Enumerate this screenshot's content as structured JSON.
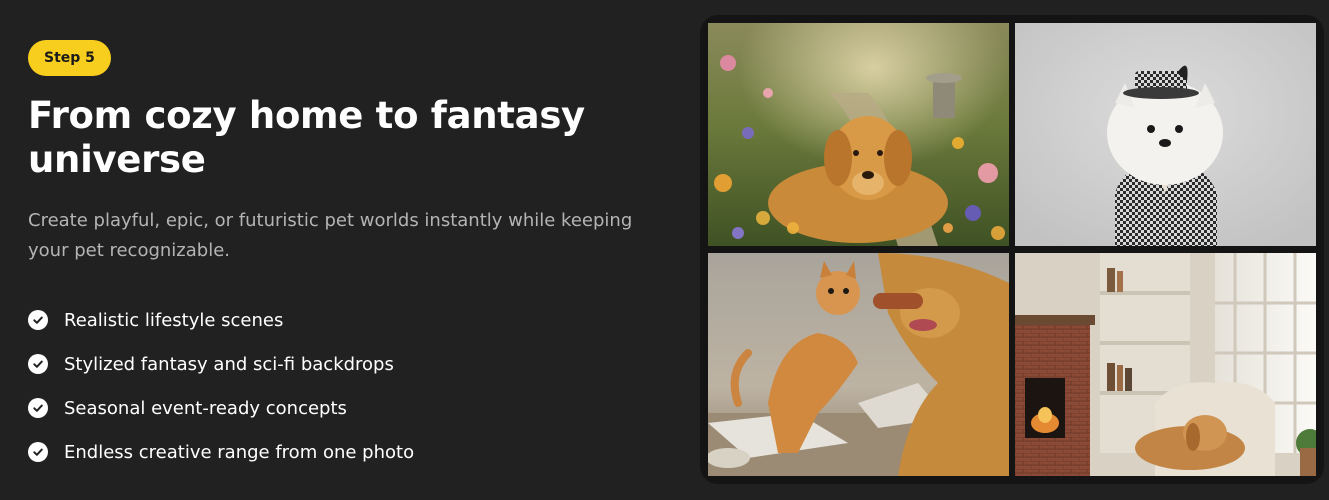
{
  "step_badge": "Step 5",
  "title": "From cozy home to fantasy universe",
  "subtitle": "Create playful, epic, or futuristic pet worlds instantly while keeping your pet recognizable.",
  "features": [
    {
      "label": "Realistic lifestyle scenes",
      "icon": "check-circle-icon"
    },
    {
      "label": "Stylized fantasy and sci-fi backdrops",
      "icon": "check-circle-icon"
    },
    {
      "label": "Seasonal event-ready concepts",
      "icon": "check-circle-icon"
    },
    {
      "label": "Endless creative range from one photo",
      "icon": "check-circle-icon"
    }
  ],
  "gallery": [
    {
      "name": "golden-retriever-garden-image"
    },
    {
      "name": "pomeranian-in-suit-image"
    },
    {
      "name": "cat-and-dog-playing-image"
    },
    {
      "name": "dog-by-fireplace-image"
    }
  ],
  "colors": {
    "background": "#212121",
    "badge": "#f7cd1e",
    "subtitle_text": "#b4b4b4",
    "panel": "#141414"
  }
}
